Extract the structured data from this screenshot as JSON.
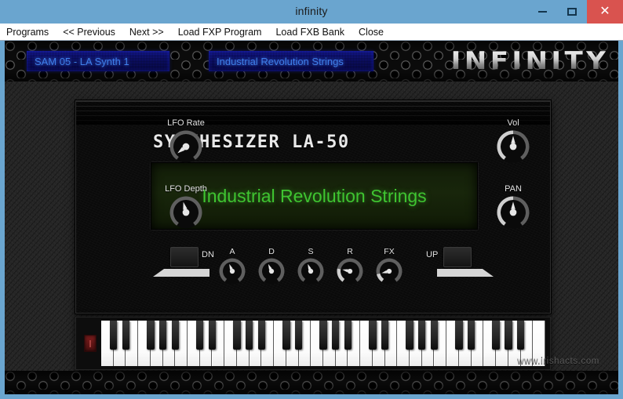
{
  "window": {
    "title": "infinity",
    "controls": {
      "minimize": "–",
      "maximize": "□",
      "close": "✕"
    }
  },
  "menubar": {
    "items": [
      {
        "label": "Programs"
      },
      {
        "label": "<< Previous"
      },
      {
        "label": "Next >>"
      },
      {
        "label": "Load FXP Program"
      },
      {
        "label": "Load FXB Bank"
      },
      {
        "label": "Close"
      }
    ]
  },
  "banner": {
    "bank_display": "SAM 05 - LA Synth 1",
    "preset_display": "Industrial Revolution Strings",
    "brand": "INFINITY",
    "led_color": "#3f7fe8",
    "plaque_color": "#0d1070"
  },
  "synth": {
    "title": "SYNTHESIZER LA-50",
    "lcd_text": "Industrial Revolution Strings",
    "lcd_color": "#3fc431",
    "lcd_background": "#18260b",
    "knobs_left": [
      {
        "label": "LFO Rate",
        "angle": -128
      },
      {
        "label": "LFO Depth",
        "angle": -14
      }
    ],
    "knobs_right": [
      {
        "label": "Vol",
        "angle": 0
      },
      {
        "label": "PAN",
        "angle": 0
      }
    ],
    "knobs_bottom": [
      {
        "label": "A",
        "angle": -22
      },
      {
        "label": "D",
        "angle": -24
      },
      {
        "label": "S",
        "angle": -22
      },
      {
        "label": "R",
        "angle": -78
      },
      {
        "label": "FX",
        "angle": -104
      }
    ],
    "step_down": {
      "label": "DN"
    },
    "step_up": {
      "label": "UP"
    }
  },
  "keyboard": {
    "white_key_count": 36,
    "indicator_color": "#7e1d1d"
  },
  "watermark": "www.irishacts.com"
}
